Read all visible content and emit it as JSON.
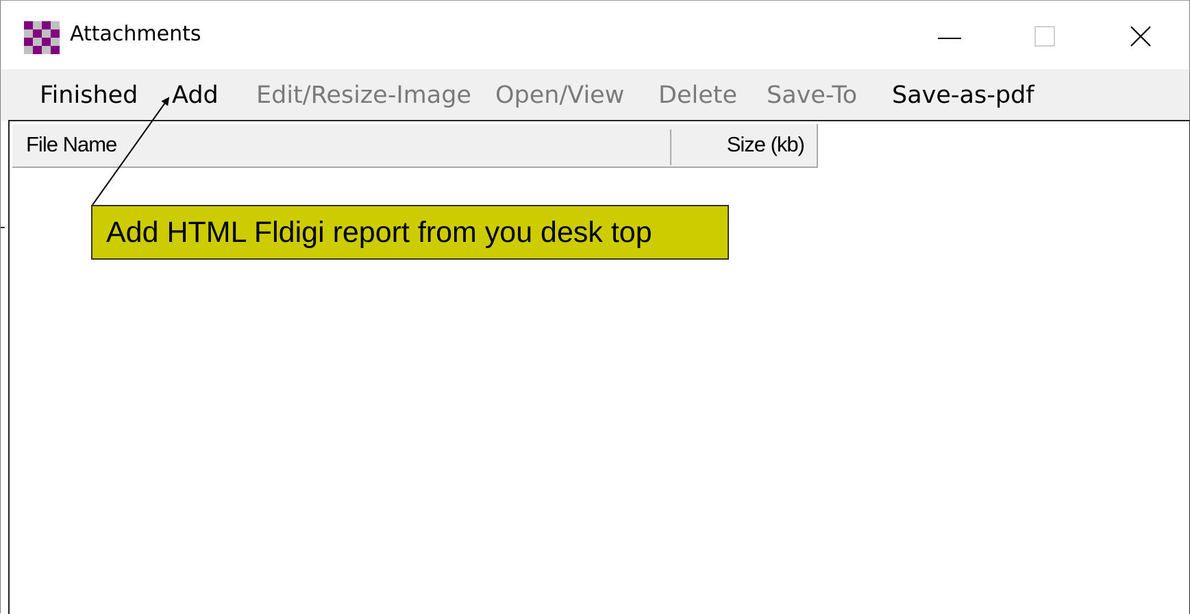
{
  "window": {
    "title": "Attachments",
    "icon": "checkerboard-app-icon",
    "controls": {
      "minimize": "minimize-icon",
      "maximize": "maximize-icon",
      "close": "close-icon"
    }
  },
  "menu": {
    "items": [
      {
        "label": "Finished",
        "enabled": true
      },
      {
        "label": "Add",
        "enabled": true
      },
      {
        "label": "Edit/Resize-Image",
        "enabled": false
      },
      {
        "label": "Open/View",
        "enabled": false
      },
      {
        "label": "Delete",
        "enabled": false
      },
      {
        "label": "Save-To",
        "enabled": false
      },
      {
        "label": "Save-as-pdf",
        "enabled": true
      }
    ]
  },
  "list": {
    "columns": [
      "File Name",
      "Size (kb)"
    ],
    "rows": []
  },
  "callout": {
    "text": "Add HTML Fldigi report from you desk top",
    "background": "#cccc00"
  },
  "colors": {
    "icon_purple": "#800080",
    "icon_light": "#c0c0c0",
    "disabled_text": "#7a7a7a",
    "menubar_bg": "#f0f0f0"
  }
}
